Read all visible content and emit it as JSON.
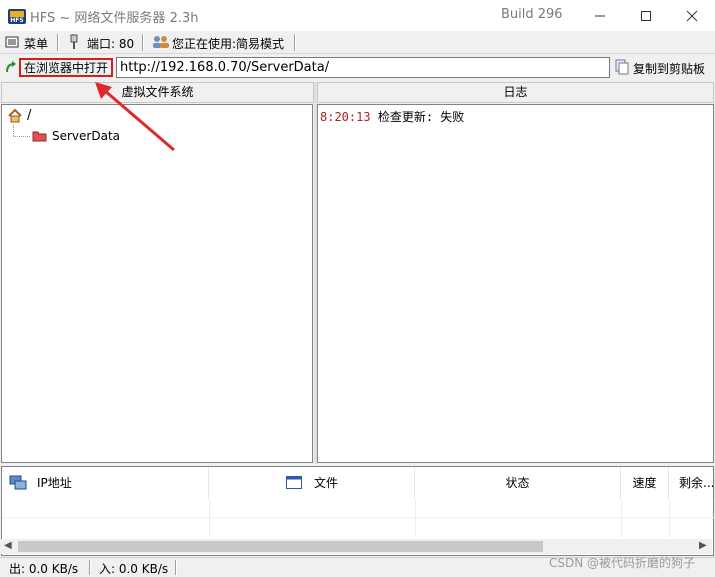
{
  "window": {
    "title": "HFS ~ 网络文件服务器 2.3h",
    "build": "Build 296"
  },
  "toolbar": {
    "menu_label": "菜单",
    "port_label": "端口: 80",
    "mode_label": "您正在使用:简易模式"
  },
  "urlbar": {
    "open_in_browser_label": "在浏览器中打开",
    "url_value": "http://192.168.0.70/ServerData/",
    "copy_label": "复制到剪贴板"
  },
  "vfs": {
    "header": "虚拟文件系统",
    "root_label": "/",
    "folder_label": "ServerData"
  },
  "log": {
    "header": "日志",
    "entries": [
      {
        "time": "8:20:13",
        "message": "检查更新: 失败"
      }
    ]
  },
  "connections": {
    "columns": [
      "IP地址",
      "文件",
      "状态",
      "速度",
      "剩余..."
    ]
  },
  "status": {
    "out": "出: 0.0 KB/s",
    "in": "入: 0.0 KB/s"
  },
  "watermark": "CSDN @被代码折磨的狗子",
  "colors": {
    "log_time": "#b02020",
    "highlight_border": "#d02020",
    "annotation_arrow": "#e02a2a"
  }
}
